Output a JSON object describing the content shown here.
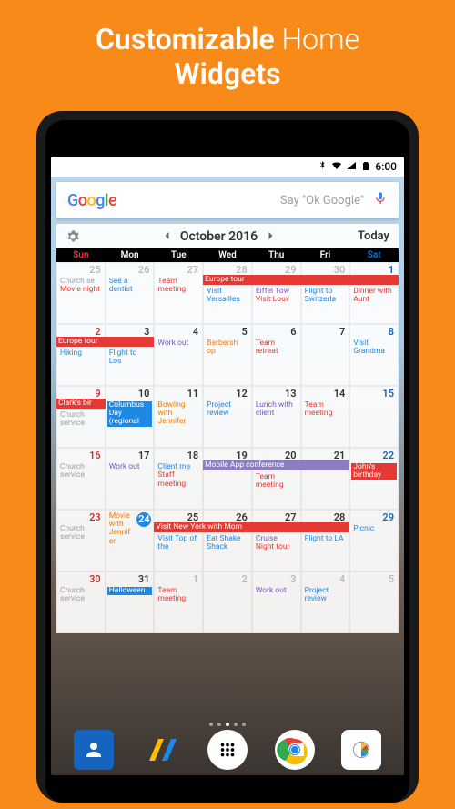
{
  "promo": {
    "line1a": "Customizable",
    "line1b": "Home",
    "line2": "Widgets"
  },
  "status": {
    "time": "6:00"
  },
  "search": {
    "ok_google": "Say \"Ok Google\""
  },
  "widget_header": {
    "month": "October 2016",
    "today": "Today"
  },
  "day_labels": [
    "Sun",
    "Mon",
    "Tue",
    "Wed",
    "Thu",
    "Fri",
    "Sat"
  ],
  "events": {
    "r0c0": [
      {
        "t": "Church se",
        "c": "gray"
      },
      {
        "t": "Movie night",
        "c": "red"
      }
    ],
    "r0c1": [
      {
        "t": "See a dentist",
        "c": "blue"
      }
    ],
    "r0c2": [
      {
        "t": "Team meeting",
        "c": "red"
      }
    ],
    "r0c3": [
      {
        "t": "Visit Versailles",
        "c": "blue"
      }
    ],
    "r0c4": [
      {
        "t": "Eiffel Tow",
        "c": "purple"
      },
      {
        "t": "Visit Louv",
        "c": "red"
      }
    ],
    "r0c5": [
      {
        "t": "Flight to Switzerla",
        "c": "blue"
      }
    ],
    "r0c6": [
      {
        "t": "Dinner with Aunt",
        "c": "red"
      }
    ],
    "r1c0": [
      {
        "t": "Hiking",
        "c": "blue"
      }
    ],
    "r1c1": [
      {
        "t": "Flight to Los",
        "c": "blue"
      }
    ],
    "r1c2": [
      {
        "t": "Work out",
        "c": "purple"
      }
    ],
    "r1c3": [
      {
        "t": "Barbersh op",
        "c": "orange"
      }
    ],
    "r1c4": [
      {
        "t": "Team retreat",
        "c": "red"
      }
    ],
    "r1c6": [
      {
        "t": "Visit Grandma",
        "c": "blue"
      }
    ],
    "r2c0": [
      {
        "t": "Church service",
        "c": "gray"
      }
    ],
    "r2c1": [
      {
        "t": "Columbus Day (regional",
        "c": "blue-bg"
      }
    ],
    "r2c2": [
      {
        "t": "Bowling with Jennifer",
        "c": "orange"
      }
    ],
    "r2c3": [
      {
        "t": "Project review",
        "c": "blue"
      }
    ],
    "r2c4": [
      {
        "t": "Lunch with client",
        "c": "purple"
      }
    ],
    "r2c5": [
      {
        "t": "Team meeting",
        "c": "red"
      }
    ],
    "r3c0": [
      {
        "t": "Church service",
        "c": "gray"
      }
    ],
    "r3c1": [
      {
        "t": "Work out",
        "c": "purple"
      }
    ],
    "r3c2": [
      {
        "t": "Client me",
        "c": "blue"
      },
      {
        "t": "Staff meeting",
        "c": "red"
      }
    ],
    "r3c4": [
      {
        "t": "Team meeting",
        "c": "red"
      }
    ],
    "r3c6": [
      {
        "t": "John's birthday",
        "c": "red-bg"
      }
    ],
    "r4c0": [
      {
        "t": "Church service",
        "c": "gray"
      }
    ],
    "r4c1": [
      {
        "t": "Movie with Jennifer",
        "c": "orange"
      }
    ],
    "r4c2": [
      {
        "t": "Visit Top of the",
        "c": "blue"
      }
    ],
    "r4c3": [
      {
        "t": "Eat Shake Shack",
        "c": "blue"
      }
    ],
    "r4c4": [
      {
        "t": "Cruise",
        "c": "purple"
      },
      {
        "t": "Night tour",
        "c": "red"
      }
    ],
    "r4c5": [
      {
        "t": "Flight to LA",
        "c": "blue"
      }
    ],
    "r4c6": [
      {
        "t": "Picnic",
        "c": "blue"
      }
    ],
    "r5c0": [
      {
        "t": "Church service",
        "c": "gray"
      }
    ],
    "r5c1": [
      {
        "t": "Halloween",
        "c": "blue-bg"
      }
    ],
    "r5c2": [
      {
        "t": "Team meeting",
        "c": "red"
      }
    ],
    "r5c4": [
      {
        "t": "Work out",
        "c": "purple"
      }
    ],
    "r5c5": [
      {
        "t": "Project review",
        "c": "blue"
      }
    ]
  },
  "banners": {
    "europe1": "Europe tour",
    "europe2": "Europe tour",
    "clark": "Clark's bir",
    "mobile": "Mobile App conference",
    "nyc": "Visit New York with Mom"
  },
  "day_numbers": [
    [
      "25",
      "26",
      "27",
      "28",
      "29",
      "30",
      "1"
    ],
    [
      "2",
      "3",
      "4",
      "5",
      "6",
      "7",
      "8"
    ],
    [
      "9",
      "10",
      "11",
      "12",
      "13",
      "14",
      "15"
    ],
    [
      "16",
      "17",
      "18",
      "19",
      "20",
      "21",
      "22"
    ],
    [
      "23",
      "24",
      "25",
      "26",
      "27",
      "28",
      "29"
    ],
    [
      "30",
      "31",
      "1",
      "2",
      "3",
      "4",
      "5"
    ]
  ]
}
